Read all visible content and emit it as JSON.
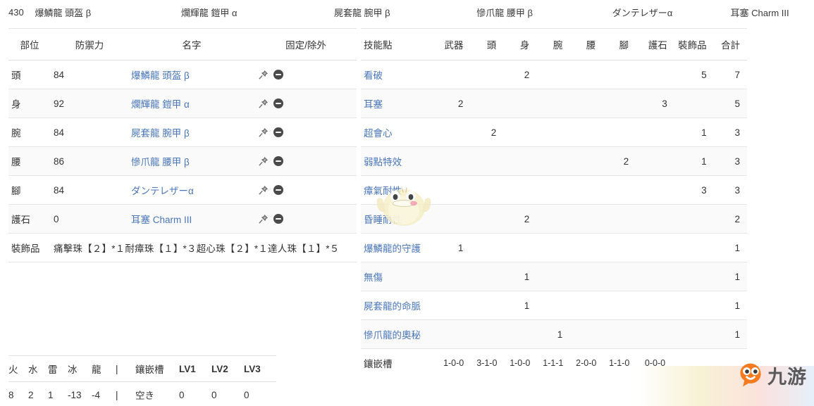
{
  "summary": {
    "total_defense": "430",
    "items": [
      "爆鱗龍 頭盔 β",
      "爛輝龍 鎧甲 α",
      "屍套龍 腕甲 β",
      "慘爪龍 腰甲 β",
      "ダンテレザーα",
      "耳塞 Charm III"
    ]
  },
  "armor_table": {
    "headers": [
      "部位",
      "防禦力",
      "名字",
      "固定/除外"
    ],
    "rows": [
      {
        "part": "頭",
        "defense": "84",
        "name": "爆鱗龍 頭盔 β"
      },
      {
        "part": "身",
        "defense": "92",
        "name": "爛輝龍 鎧甲 α"
      },
      {
        "part": "腕",
        "defense": "84",
        "name": "屍套龍 腕甲 β"
      },
      {
        "part": "腰",
        "defense": "86",
        "name": "慘爪龍 腰甲 β"
      },
      {
        "part": "腳",
        "defense": "84",
        "name": "ダンテレザーα"
      },
      {
        "part": "護石",
        "defense": "0",
        "name": "耳塞 Charm III"
      }
    ],
    "decoration_label": "裝飾品",
    "decoration_text": "痛擊珠【２】*１耐瘴珠【１】*３超心珠【２】*１達人珠【１】*５",
    "icons": {
      "pin": "pin-icon",
      "exclude": "minus-circle-icon"
    }
  },
  "skills_table": {
    "headers": [
      "技能點",
      "武器",
      "頭",
      "身",
      "腕",
      "腰",
      "腳",
      "護石",
      "裝飾品",
      "合計"
    ],
    "rows": [
      {
        "skill": "看破",
        "values": [
          "",
          "",
          "2",
          "",
          "",
          "",
          "",
          "5",
          "7"
        ]
      },
      {
        "skill": "耳塞",
        "values": [
          "2",
          "",
          "",
          "",
          "",
          "",
          "3",
          "",
          "5"
        ]
      },
      {
        "skill": "超會心",
        "values": [
          "",
          "2",
          "",
          "",
          "",
          "",
          "",
          "1",
          "3"
        ]
      },
      {
        "skill": "弱點特效",
        "values": [
          "",
          "",
          "",
          "",
          "",
          "2",
          "",
          "1",
          "3"
        ]
      },
      {
        "skill": "瘴氣耐性",
        "values": [
          "",
          "",
          "",
          "",
          "",
          "",
          "",
          "3",
          "3"
        ]
      },
      {
        "skill": "昏睡耐性",
        "values": [
          "",
          "",
          "2",
          "",
          "",
          "",
          "",
          "",
          "2"
        ]
      },
      {
        "skill": "爆鱗龍的守護",
        "values": [
          "1",
          "",
          "",
          "",
          "",
          "",
          "",
          "",
          "1"
        ]
      },
      {
        "skill": "無傷",
        "values": [
          "",
          "",
          "1",
          "",
          "",
          "",
          "",
          "",
          "1"
        ]
      },
      {
        "skill": "屍套龍的命脈",
        "values": [
          "",
          "",
          "1",
          "",
          "",
          "",
          "",
          "",
          "1"
        ]
      },
      {
        "skill": "慘爪龍的奧秘",
        "values": [
          "",
          "",
          "",
          "1",
          "",
          "",
          "",
          "",
          "1"
        ]
      }
    ],
    "slots_label": "鑲嵌槽",
    "slots_values": [
      "1-0-0",
      "3-1-0",
      "1-0-0",
      "1-1-1",
      "2-0-0",
      "1-1-0",
      "0-0-0",
      "",
      ""
    ]
  },
  "resist_table": {
    "headers": [
      "火",
      "水",
      "雷",
      "冰",
      "龍",
      "|",
      "鑲嵌槽",
      "LV1",
      "LV2",
      "LV3"
    ],
    "values": [
      "8",
      "2",
      "1",
      "-13",
      "-4",
      "|",
      "空き",
      "0",
      "0",
      "0"
    ]
  },
  "watermark": {
    "brand_text": "九游",
    "bird": "bird-mascot-icon"
  },
  "colors": {
    "link": "#4a76b8",
    "text": "#333333",
    "row_stripe": "#fafafa",
    "border": "#e6e6e6",
    "brand_orange": "#f47b20"
  }
}
